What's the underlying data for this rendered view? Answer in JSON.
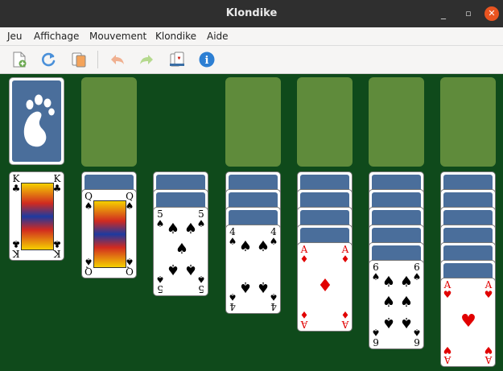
{
  "window": {
    "title": "Klondike",
    "minimize_glyph": "_",
    "maximize_glyph": "▫",
    "close_glyph": "✕"
  },
  "menu": {
    "items": [
      "Jeu",
      "Affichage",
      "Mouvement",
      "Klondike",
      "Aide"
    ]
  },
  "toolbar": {
    "icons": [
      "new-game-icon",
      "restart-icon",
      "select-game-icon",
      "undo-icon",
      "redo-icon",
      "hint-icon",
      "info-icon"
    ],
    "info_glyph": "i"
  },
  "colors": {
    "felt": "#0f4a1b",
    "slot": "#5f8b3b",
    "card_back": "#4a6e9b",
    "red_suit": "#e10000"
  },
  "board": {
    "stock_logo": "gnome-foot-icon",
    "tableau": [
      {
        "face_down": 0,
        "face_up": [
          {
            "rank": "K",
            "suit": "♣",
            "color": "black"
          }
        ]
      },
      {
        "face_down": 1,
        "face_up": [
          {
            "rank": "Q",
            "suit": "♠",
            "color": "black"
          }
        ]
      },
      {
        "face_down": 2,
        "face_up": [
          {
            "rank": "5",
            "suit": "♠",
            "color": "black"
          }
        ]
      },
      {
        "face_down": 3,
        "face_up": [
          {
            "rank": "4",
            "suit": "♠",
            "color": "black"
          }
        ]
      },
      {
        "face_down": 4,
        "face_up": [
          {
            "rank": "A",
            "suit": "♦",
            "color": "red"
          }
        ]
      },
      {
        "face_down": 5,
        "face_up": [
          {
            "rank": "6",
            "suit": "♠",
            "color": "black"
          }
        ]
      },
      {
        "face_down": 6,
        "face_up": [
          {
            "rank": "A",
            "suit": "♥",
            "color": "red"
          }
        ]
      }
    ]
  }
}
